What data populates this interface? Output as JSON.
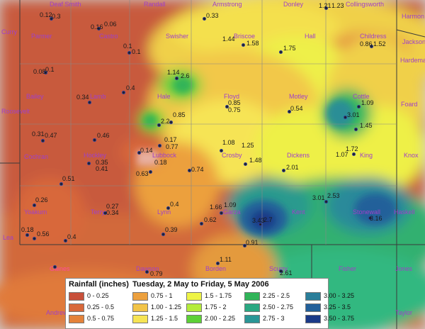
{
  "legend": {
    "title": "Rainfall (inches)",
    "subtitle": "Tuesday, 2 May to Friday, 5 May 2006",
    "items": [
      {
        "label": "0 - 0.25",
        "color": "#c8503a"
      },
      {
        "label": "0.25 - 0.5",
        "color": "#d8683a"
      },
      {
        "label": "0.5 - 0.75",
        "color": "#e4823a"
      },
      {
        "label": "0.75 - 1",
        "color": "#eca03e"
      },
      {
        "label": "1.00 - 1.25",
        "color": "#f2c448"
      },
      {
        "label": "1.25 - 1.5",
        "color": "#f6e454"
      },
      {
        "label": "1.5 - 1.75",
        "color": "#eef446"
      },
      {
        "label": "1.75 - 2",
        "color": "#b4ec3a"
      },
      {
        "label": "2.00 - 2.25",
        "color": "#5cd036"
      },
      {
        "label": "2.25 - 2.5",
        "color": "#30b458"
      },
      {
        "label": "2.50 - 2.75",
        "color": "#2aa882"
      },
      {
        "label": "2.75 - 3",
        "color": "#2a9696"
      },
      {
        "label": "3.00 - 3.25",
        "color": "#2a7e9a"
      },
      {
        "label": "3.25 - 3.5",
        "color": "#22609a"
      },
      {
        "label": "3.50 - 3.75",
        "color": "#1a3a88"
      }
    ]
  },
  "counties": [
    {
      "name": "Deaf Smith"
    },
    {
      "name": "Randall"
    },
    {
      "name": "Armstrong"
    },
    {
      "name": "Donley"
    },
    {
      "name": "Collingsworth"
    },
    {
      "name": "Harmon"
    },
    {
      "name": "Curry"
    },
    {
      "name": "Parmer"
    },
    {
      "name": "Castro"
    },
    {
      "name": "Swisher"
    },
    {
      "name": "Briscoe"
    },
    {
      "name": "Hall"
    },
    {
      "name": "Childress"
    },
    {
      "name": "Jackson"
    },
    {
      "name": "Hardeman"
    },
    {
      "name": "Bailey"
    },
    {
      "name": "Lamb"
    },
    {
      "name": "Hale"
    },
    {
      "name": "Floyd"
    },
    {
      "name": "Motley"
    },
    {
      "name": "Cottle"
    },
    {
      "name": "Foard"
    },
    {
      "name": "Roosevelt"
    },
    {
      "name": "Cochran"
    },
    {
      "name": "Hockley"
    },
    {
      "name": "Lubbock"
    },
    {
      "name": "Crosby"
    },
    {
      "name": "Dickens"
    },
    {
      "name": "King"
    },
    {
      "name": "Knox"
    },
    {
      "name": "Yoakum"
    },
    {
      "name": "Terry"
    },
    {
      "name": "Lynn"
    },
    {
      "name": "Garza"
    },
    {
      "name": "Kent"
    },
    {
      "name": "Stonewall"
    },
    {
      "name": "Haskell"
    },
    {
      "name": "Lea"
    },
    {
      "name": "Gaines"
    },
    {
      "name": "Dawson"
    },
    {
      "name": "Borden"
    },
    {
      "name": "Scurry"
    },
    {
      "name": "Fisher"
    },
    {
      "name": "Jones"
    },
    {
      "name": "Andrews"
    },
    {
      "name": "Taylor"
    }
  ],
  "stations": [
    "0.12",
    "0.3",
    "0.16",
    "0.06",
    "0.33",
    "1.21",
    "1.23",
    "1.44",
    "1.58",
    "0.1",
    "0.1",
    "1.75",
    "0.86",
    "1.52",
    "0.08",
    "0.1",
    "1.14",
    "2.6",
    "0.34",
    "0.4",
    "1.09",
    "0.85",
    "0.75",
    "0.54",
    "3.01",
    "2.2",
    "0.85",
    "1.45",
    "0.31",
    "0.47",
    "0.46",
    "0.17",
    "0.77",
    "1.08",
    "1.25",
    "0.14",
    "0.35",
    "0.41",
    "1.72",
    "1.07",
    "0.18",
    "1.48",
    "0.74",
    "2.01",
    "0.63",
    "0.51",
    "0.26",
    "3.01",
    "2.53",
    "0.27",
    "0.34",
    "0.4",
    "1.66",
    "1.09",
    "0.62",
    "3.16",
    "3.43",
    "2.7",
    "0.18",
    "0.56",
    "0.4",
    "0.39",
    "0.91",
    "1.11",
    "0.79",
    "2.61"
  ]
}
